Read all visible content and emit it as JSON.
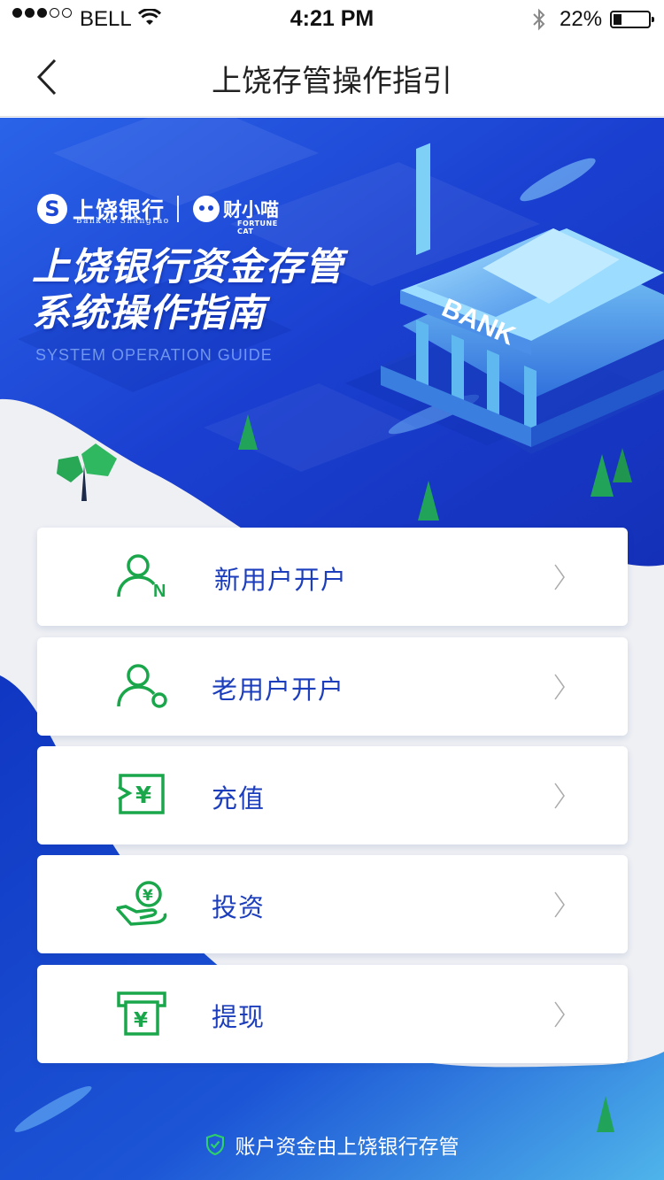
{
  "status_bar": {
    "carrier": "BELL",
    "time": "4:21 PM",
    "battery_percent": "22%",
    "signal_bars_filled": 3,
    "signal_bars_total": 5,
    "battery_level": 0.22
  },
  "nav": {
    "title": "上饶存管操作指引",
    "back_icon": "chevron-left-icon"
  },
  "hero": {
    "bank_name_cn": "上饶银行",
    "bank_name_en": "Bank of Shangrao",
    "partner_name_cn": "财小喵",
    "partner_name_en": "FORTUNE CAT",
    "title_line1": "上饶银行资金存管",
    "title_line2": "系统操作指南",
    "subtitle": "SYSTEM OPERATION GUIDE",
    "building_sign": "BANK"
  },
  "menu": {
    "items": [
      {
        "label": "新用户开户",
        "icon": "new-user-icon"
      },
      {
        "label": "老用户开户",
        "icon": "old-user-icon"
      },
      {
        "label": "充值",
        "icon": "recharge-icon"
      },
      {
        "label": "投资",
        "icon": "invest-icon"
      },
      {
        "label": "提现",
        "icon": "withdraw-icon"
      }
    ]
  },
  "footer": {
    "text": "账户资金由上饶银行存管",
    "icon": "shield-check-icon"
  },
  "colors": {
    "brand_blue": "#1c46d4",
    "icon_green": "#1aa64a",
    "label_blue": "#1c3ebd"
  }
}
